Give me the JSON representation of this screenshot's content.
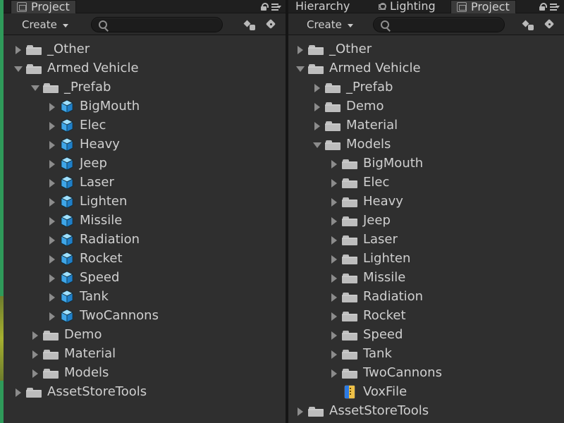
{
  "left_panel": {
    "tabs": [
      {
        "label": "Project",
        "active": true
      }
    ],
    "toolbar": {
      "create_label": "Create",
      "search_placeholder": ""
    },
    "tree": [
      {
        "label": "_Other",
        "icon": "folder-icon",
        "depth": 0,
        "state": "collapsed"
      },
      {
        "label": "Armed Vehicle",
        "icon": "folder-icon",
        "depth": 0,
        "state": "expanded"
      },
      {
        "label": "_Prefab",
        "icon": "folder-icon",
        "depth": 1,
        "state": "expanded"
      },
      {
        "label": "BigMouth",
        "icon": "prefab-icon",
        "depth": 2,
        "state": "collapsed"
      },
      {
        "label": "Elec",
        "icon": "prefab-icon",
        "depth": 2,
        "state": "collapsed"
      },
      {
        "label": "Heavy",
        "icon": "prefab-icon",
        "depth": 2,
        "state": "collapsed"
      },
      {
        "label": "Jeep",
        "icon": "prefab-icon",
        "depth": 2,
        "state": "collapsed"
      },
      {
        "label": "Laser",
        "icon": "prefab-icon",
        "depth": 2,
        "state": "collapsed"
      },
      {
        "label": "Lighten",
        "icon": "prefab-icon",
        "depth": 2,
        "state": "collapsed"
      },
      {
        "label": "Missile",
        "icon": "prefab-icon",
        "depth": 2,
        "state": "collapsed"
      },
      {
        "label": "Radiation",
        "icon": "prefab-icon",
        "depth": 2,
        "state": "collapsed"
      },
      {
        "label": "Rocket",
        "icon": "prefab-icon",
        "depth": 2,
        "state": "collapsed"
      },
      {
        "label": "Speed",
        "icon": "prefab-icon",
        "depth": 2,
        "state": "collapsed"
      },
      {
        "label": "Tank",
        "icon": "prefab-icon",
        "depth": 2,
        "state": "collapsed"
      },
      {
        "label": "TwoCannons",
        "icon": "prefab-icon",
        "depth": 2,
        "state": "collapsed"
      },
      {
        "label": "Demo",
        "icon": "folder-icon",
        "depth": 1,
        "state": "collapsed"
      },
      {
        "label": "Material",
        "icon": "folder-icon",
        "depth": 1,
        "state": "collapsed"
      },
      {
        "label": "Models",
        "icon": "folder-icon",
        "depth": 1,
        "state": "collapsed"
      },
      {
        "label": "AssetStoreTools",
        "icon": "folder-icon",
        "depth": 0,
        "state": "collapsed"
      }
    ]
  },
  "right_panel": {
    "tabs": [
      {
        "label": "Hierarchy",
        "active": false
      },
      {
        "label": "Lighting",
        "active": false
      },
      {
        "label": "Project",
        "active": true
      }
    ],
    "toolbar": {
      "create_label": "Create",
      "search_placeholder": ""
    },
    "tree": [
      {
        "label": "_Other",
        "icon": "folder-icon",
        "depth": 0,
        "state": "collapsed"
      },
      {
        "label": "Armed Vehicle",
        "icon": "folder-icon",
        "depth": 0,
        "state": "expanded"
      },
      {
        "label": "_Prefab",
        "icon": "folder-icon",
        "depth": 1,
        "state": "collapsed"
      },
      {
        "label": "Demo",
        "icon": "folder-icon",
        "depth": 1,
        "state": "collapsed"
      },
      {
        "label": "Material",
        "icon": "folder-icon",
        "depth": 1,
        "state": "collapsed"
      },
      {
        "label": "Models",
        "icon": "folder-icon",
        "depth": 1,
        "state": "expanded"
      },
      {
        "label": "BigMouth",
        "icon": "folder-icon",
        "depth": 2,
        "state": "collapsed"
      },
      {
        "label": "Elec",
        "icon": "folder-icon",
        "depth": 2,
        "state": "collapsed"
      },
      {
        "label": "Heavy",
        "icon": "folder-icon",
        "depth": 2,
        "state": "collapsed"
      },
      {
        "label": "Jeep",
        "icon": "folder-icon",
        "depth": 2,
        "state": "collapsed"
      },
      {
        "label": "Laser",
        "icon": "folder-icon",
        "depth": 2,
        "state": "collapsed"
      },
      {
        "label": "Lighten",
        "icon": "folder-icon",
        "depth": 2,
        "state": "collapsed"
      },
      {
        "label": "Missile",
        "icon": "folder-icon",
        "depth": 2,
        "state": "collapsed"
      },
      {
        "label": "Radiation",
        "icon": "folder-icon",
        "depth": 2,
        "state": "collapsed"
      },
      {
        "label": "Rocket",
        "icon": "folder-icon",
        "depth": 2,
        "state": "collapsed"
      },
      {
        "label": "Speed",
        "icon": "folder-icon",
        "depth": 2,
        "state": "collapsed"
      },
      {
        "label": "Tank",
        "icon": "folder-icon",
        "depth": 2,
        "state": "collapsed"
      },
      {
        "label": "TwoCannons",
        "icon": "folder-icon",
        "depth": 2,
        "state": "collapsed"
      },
      {
        "label": "VoxFile",
        "icon": "voxfile-icon",
        "depth": 2,
        "state": "none"
      },
      {
        "label": "AssetStoreTools",
        "icon": "folder-icon",
        "depth": 0,
        "state": "collapsed"
      }
    ]
  },
  "colors": {
    "panel_bg": "#2f2f2f",
    "toolbar_bg": "#2a2a2a",
    "tab_bg": "#1f1f1f",
    "text": "#cfcfcf",
    "prefab_blue": "#6cc6ff"
  }
}
